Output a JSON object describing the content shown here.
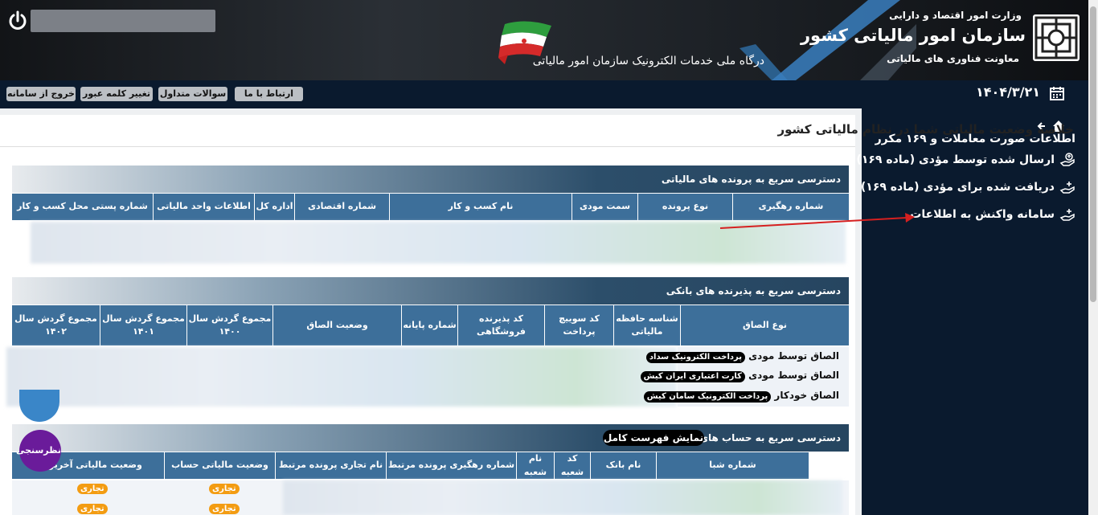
{
  "header": {
    "ministry": "وزارت امور اقتصاد و دارایی",
    "org_name": "سازمان امور مالیاتی کشور",
    "deputy": "معاونت فناوری های مالیاتی",
    "portal": "درگاه ملی خدمات الکترونیک سازمان امور مالیاتی"
  },
  "topbar": {
    "date": "۱۴۰۴/۳/۲۱",
    "logout": "خروج از سامانه",
    "change_password": "تغییر کلمه عبور",
    "faq": "سوالات متداول",
    "contact": "ارتباط با ما"
  },
  "sidebar": {
    "heading": "اطلاعات صورت معاملات و ۱۶۹ مکرر",
    "items": [
      {
        "label": "ارسال شده توسط مؤدی (ماده ۱۶۹)",
        "icon": "hand-upload-icon"
      },
      {
        "label": "دریافت شده برای مؤدی (ماده ۱۶۹)",
        "icon": "hand-plus-icon"
      },
      {
        "label": "سامانه واکنش به اطلاعات",
        "icon": "hand-plus-icon"
      }
    ]
  },
  "main": {
    "title": "خلاصه وضعیت مالیاتی شما در نظام مالیاتی کشور",
    "section1": {
      "title": "دسترسی سریع به پرونده های مالیاتی",
      "columns": [
        "شماره رهگیری",
        "نوع پرونده",
        "سمت مودی",
        "نام کسب و کار",
        "شماره اقتصادی",
        "اداره کل",
        "اطلاعات واحد مالیاتی",
        "شماره پستی محل کسب و کار"
      ]
    },
    "section2": {
      "title": "دسترسی سریع به پذیرنده های بانکی",
      "columns": [
        "نوع الصاق",
        "شناسه حافظه مالیاتی",
        "کد سوییچ پرداخت",
        "کد پذیرنده فروشگاهی",
        "شماره پایانه",
        "وضعیت الصاق",
        "مجموع گردش سال ۱۴۰۰",
        "مجموع گردش سال ۱۴۰۱",
        "مجموع گردش سال ۱۴۰۲"
      ],
      "rows": [
        {
          "type": "الصاق توسط مودی",
          "badge": "پرداخت الکترونیک سداد"
        },
        {
          "type": "الصاق توسط مودی",
          "badge": "کارت اعتباری ایران کیش"
        },
        {
          "type": "الصاق خودکار",
          "badge": "پرداخت الکترونیک سامان کیش"
        }
      ]
    },
    "section3": {
      "title": "دسترسی سریع به حساب های بانکی",
      "show_all": "نمایش فهرست کامل",
      "columns": [
        "شماره شبا",
        "نام بانک",
        "کد شعبه",
        "نام شعبه",
        "شماره رهگیری پرونده مرتبط",
        "نام تجاری پرونده مرتبط",
        "وضعیت مالیاتی حساب",
        "وضعیت مالیاتی آخرین در"
      ],
      "tag": "تجاری"
    }
  },
  "widgets": {
    "survey": "نظرسنجی"
  },
  "colors": {
    "navy": "#0a1a2e",
    "table_header": "#3d6f9a",
    "tag": "#f39c12",
    "survey": "#6a1b9a"
  }
}
